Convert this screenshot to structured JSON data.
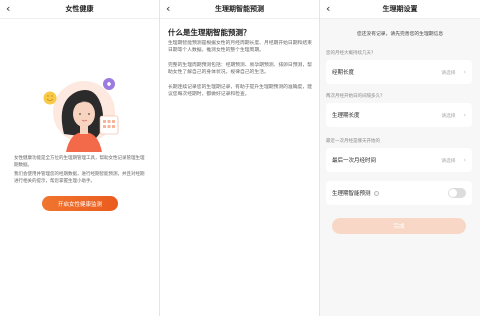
{
  "colors": {
    "accent": "#ec6424",
    "done_disabled": "#f8d7c6"
  },
  "icons": {
    "back": "chevron-left-icon",
    "chev": "chevron-right-icon",
    "info": "info-icon"
  },
  "panel1": {
    "back_glyph": "‹",
    "title": "女性健康",
    "desc1": "女性健康功能是全方位的生理期管理工具，帮助女性记录管理生理期数据。",
    "desc2": "我们会使用并管理您的经期数据，进行经期智能预测，并且对经期进行相关的提示，帮您掌握生理小助手。",
    "button": "开启女性健康监测"
  },
  "panel2": {
    "back_glyph": "‹",
    "title": "生理期智能预测",
    "heading": "什么是生理期智能预测？",
    "para1": "生理期智能预测是根据女性的月经周期长度、月经期开始日期和结束日期等个人数据，推测女性的整个生理周期。",
    "para2": "完整的生理周期预测包括：经期预测、易孕期预测、排卵日预测，帮助女性了解自己的身体状况，规律自己的生活。",
    "para3": "长期连续记录您的生理期记录，有助于提升生理期预测的准确度，建议您每次经期时，都做好记录和检查。"
  },
  "panel3": {
    "back_glyph": "‹",
    "title": "生理期设置",
    "subtitle": "您还没有记录，请先完善您的生理期信息",
    "q1": "您的月经大概持续几天?",
    "card1_label": "经期长度",
    "card1_value": "请选择",
    "q2": "两次月经开始日的间隔多久?",
    "card2_label": "生理期长度",
    "card2_value": "请选择",
    "q3": "最近一次月经是哪天开始的",
    "card3_label": "最后一次月经时间",
    "card3_value": "请选择",
    "card4_label": "生理期智能预测",
    "toggle_on": false,
    "done": "完成",
    "chev": "›",
    "info": "i"
  }
}
